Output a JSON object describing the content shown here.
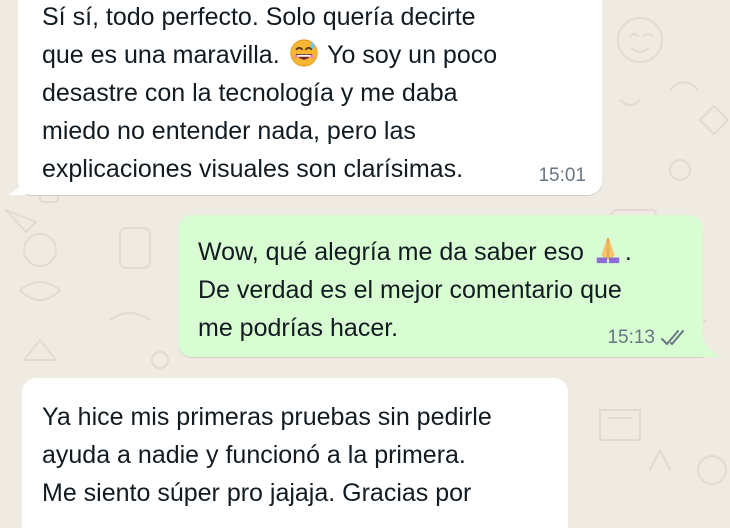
{
  "chat": {
    "messages": [
      {
        "direction": "incoming",
        "text_before_emoji": "Sí sí, todo perfecto. Solo quería decirte\nque es una maravilla. ",
        "emoji": "grinning-sweat-face",
        "text_after_emoji": " Yo soy un poco\ndesastre con la tecnología y me daba\nmiedo no entender nada, pero las\nexplicaciones visuales son clarísimas.",
        "time": "15:01"
      },
      {
        "direction": "outgoing",
        "text_before_emoji": "Wow, qué alegría me da saber eso ",
        "emoji": "folded-hands",
        "text_after_emoji": ".\nDe verdad es el mejor comentario que\nme podrías hacer.",
        "time": "15:13",
        "status": "read-double-check"
      },
      {
        "direction": "incoming",
        "text": "Ya hice mis primeras pruebas sin pedirle\nayuda a nadie y funcionó a la primera.\nMe siento súper pro jajaja. Gracias por"
      }
    ]
  },
  "colors": {
    "wallpaper": "#efeae2",
    "incoming_bubble": "#ffffff",
    "outgoing_bubble": "#d9fdd3",
    "text": "#111b21",
    "meta": "#667781"
  }
}
